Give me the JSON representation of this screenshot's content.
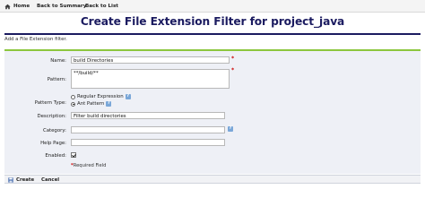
{
  "nav": {
    "home": "Home",
    "back_to_summary": "Back to Summary",
    "back_to_list": "Back to List"
  },
  "page": {
    "title": "Create File Extension Filter for project_java",
    "intro": "Add a File Extension filter."
  },
  "form": {
    "name": {
      "label": "Name:",
      "value": "build Directories"
    },
    "pattern": {
      "label": "Pattern:",
      "value": "**/build/**"
    },
    "pattern_type": {
      "label": "Pattern Type:",
      "options": [
        "Regular Expression",
        "Ant Pattern"
      ],
      "selected": "Ant Pattern"
    },
    "description": {
      "label": "Description:",
      "value": "Filter build directories"
    },
    "category": {
      "label": "Category:",
      "value": ""
    },
    "help_page": {
      "label": "Help Page:",
      "value": ""
    },
    "enabled": {
      "label": "Enabled:",
      "checked": true
    },
    "required_mark": "*",
    "required_note": "Required Field"
  },
  "actions": {
    "create": "Create",
    "cancel": "Cancel"
  },
  "colors": {
    "title": "#1b1b60",
    "accent_rule": "#8cc63e",
    "panel_bg": "#eef0f6",
    "required": "#cc0000"
  }
}
